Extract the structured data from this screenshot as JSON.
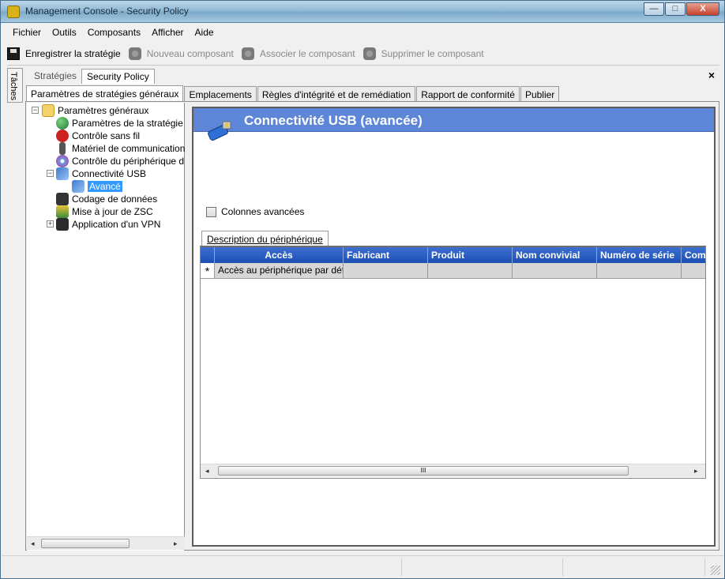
{
  "window": {
    "title": "Management Console  - Security Policy",
    "buttons": {
      "minimize": "—",
      "maximize": "□",
      "close": "X"
    }
  },
  "menu": [
    "Fichier",
    "Outils",
    "Composants",
    "Afficher",
    "Aide"
  ],
  "toolbar": {
    "save": "Enregistrer la stratégie",
    "new_component": "Nouveau composant",
    "associate_component": "Associer le composant",
    "delete_component": "Supprimer le composant"
  },
  "side_tab": "Tâches",
  "doc_tabs": [
    "Stratégies",
    "Security Policy"
  ],
  "close_glyph": "×",
  "main_tabs": [
    "Paramètres de stratégies généraux",
    "Emplacements",
    "Règles d'intégrité et de remédiation",
    "Rapport de conformité",
    "Publier"
  ],
  "tree": [
    {
      "label": "Paramètres généraux",
      "expander": "−"
    },
    {
      "label": "Paramètres de la stratégie"
    },
    {
      "label": "Contrôle sans fil"
    },
    {
      "label": "Matériel de communication"
    },
    {
      "label": "Contrôle du périphérique d"
    },
    {
      "label": "Connectivité USB",
      "expander": "−"
    },
    {
      "label": "Avancé"
    },
    {
      "label": "Codage de données"
    },
    {
      "label": "Mise à jour de ZSC"
    },
    {
      "label": "Application d'un VPN",
      "expander": "+"
    }
  ],
  "panel": {
    "title": "Connectivité USB (avancée)",
    "checkbox_label": "Colonnes avancées",
    "checkbox_checked": false,
    "grid_tab": "Description du périphérique",
    "columns": [
      "Accès",
      "Fabricant",
      "Produit",
      "Nom convivial",
      "Numéro de série",
      "Com"
    ],
    "row_marker": "*",
    "rows": [
      [
        "Accès au périphérique par déf",
        "",
        "",
        "",
        "",
        ""
      ]
    ]
  },
  "scroll_glyphs": {
    "left": "◂",
    "right": "▸",
    "grip": "III"
  },
  "colors": {
    "banner": "#5d86d9",
    "grid_header": "#2a5cc0",
    "selection": "#3399ff"
  }
}
